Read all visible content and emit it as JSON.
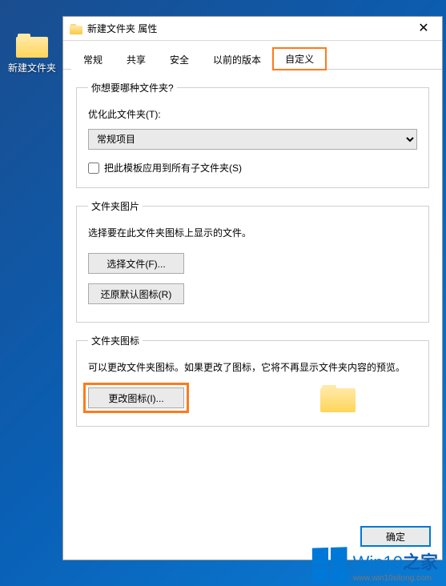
{
  "desktop": {
    "folder_label": "新建文件夹"
  },
  "dialog": {
    "title": "新建文件夹 属性",
    "close_tooltip": "关闭"
  },
  "tabs": [
    {
      "label": "常规"
    },
    {
      "label": "共享"
    },
    {
      "label": "安全"
    },
    {
      "label": "以前的版本"
    },
    {
      "label": "自定义",
      "active": true,
      "highlighted": true
    }
  ],
  "group1": {
    "legend": "你想要哪种文件夹?",
    "optimize_label": "优化此文件夹(T):",
    "dropdown_value": "常规项目",
    "apply_children_label": "把此模板应用到所有子文件夹(S)",
    "apply_children_checked": false
  },
  "group2": {
    "legend": "文件夹图片",
    "desc": "选择要在此文件夹图标上显示的文件。",
    "choose_btn": "选择文件(F)...",
    "restore_btn": "还原默认图标(R)"
  },
  "group3": {
    "legend": "文件夹图标",
    "desc": "可以更改文件夹图标。如果更改了图标，它将不再显示文件夹内容的预览。",
    "change_icon_btn": "更改图标(I)..."
  },
  "footer": {
    "ok": "确定"
  },
  "watermark": {
    "brand_main": "Win10",
    "brand_suffix": "之家",
    "url": "www.win10xitong.com"
  }
}
